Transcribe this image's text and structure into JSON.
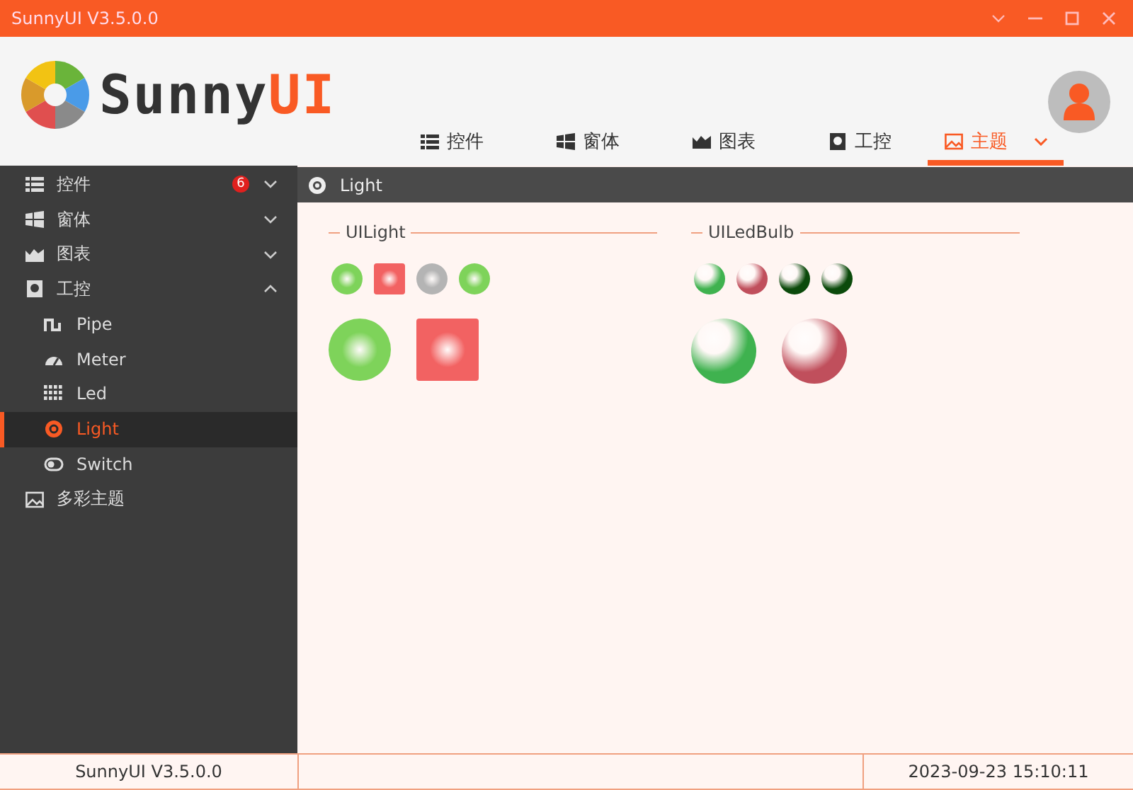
{
  "window": {
    "title": "SunnyUI V3.5.0.0"
  },
  "logo": {
    "text_main": "Sunny",
    "text_accent": "UI"
  },
  "header_tabs": [
    {
      "label": "控件",
      "selected": false
    },
    {
      "label": "窗体",
      "selected": false
    },
    {
      "label": "图表",
      "selected": false
    },
    {
      "label": "工控",
      "selected": false
    },
    {
      "label": "主题",
      "selected": true
    }
  ],
  "sidebar": {
    "items": [
      {
        "label": "控件",
        "badge": "6",
        "expanded": false,
        "selected": false
      },
      {
        "label": "窗体",
        "expanded": false,
        "selected": false
      },
      {
        "label": "图表",
        "expanded": false,
        "selected": false
      },
      {
        "label": "工控",
        "expanded": true,
        "selected": false,
        "children": [
          {
            "label": "Pipe",
            "selected": false
          },
          {
            "label": "Meter",
            "selected": false
          },
          {
            "label": "Led",
            "selected": false
          },
          {
            "label": "Light",
            "selected": true
          },
          {
            "label": "Switch",
            "selected": false
          }
        ]
      },
      {
        "label": "多彩主题",
        "selected": false
      }
    ]
  },
  "page": {
    "title": "Light",
    "groups": [
      {
        "title": "UILight",
        "kind": "light",
        "rows": [
          {
            "lights": [
              {
                "kind": "circle",
                "color": "#7ed35a"
              },
              {
                "kind": "square",
                "color": "#f26262"
              },
              {
                "kind": "circle",
                "color": "#b4b4b4"
              },
              {
                "kind": "circle",
                "color": "#7ed35a"
              }
            ]
          },
          {
            "lights": [
              {
                "kind": "circle",
                "color": "#7ed35a"
              },
              {
                "kind": "square",
                "color": "#f26262"
              }
            ]
          }
        ]
      },
      {
        "title": "UILedBulb",
        "kind": "bulb",
        "rows": [
          {
            "lights": [
              {
                "kind": "circle",
                "color": "#3fb24f"
              },
              {
                "kind": "circle",
                "color": "#c04f5c"
              },
              {
                "kind": "circle",
                "color": "#0b4a0b"
              },
              {
                "kind": "circle",
                "color": "#0b4a0b"
              }
            ]
          },
          {
            "lights": [
              {
                "kind": "circle",
                "color": "#3fb24f"
              },
              {
                "kind": "circle",
                "color": "#c04f5c"
              }
            ]
          }
        ]
      }
    ]
  },
  "status_bar": {
    "left": "SunnyUI V3.5.0.0",
    "right": "2023-09-23 15:10:11"
  }
}
